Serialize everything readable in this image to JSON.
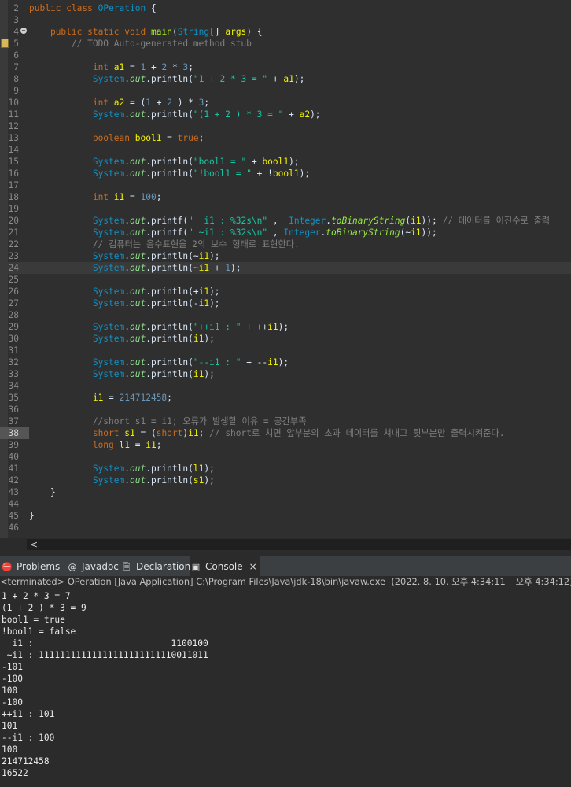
{
  "editor": {
    "fold_icon": "minus-circle-icon",
    "override_icon": "override-marker-icon",
    "lines": [
      {
        "n": "2",
        "parts": [
          [
            "kw",
            "public"
          ],
          [
            "txt",
            " "
          ],
          [
            "kw",
            "class"
          ],
          [
            "txt",
            " "
          ],
          [
            "cls",
            "OPeration"
          ],
          [
            "txt",
            " {"
          ]
        ]
      },
      {
        "n": "3",
        "parts": []
      },
      {
        "n": "4",
        "parts": [
          [
            "txt",
            "    "
          ],
          [
            "kw",
            "public"
          ],
          [
            "txt",
            " "
          ],
          [
            "kw",
            "static"
          ],
          [
            "txt",
            " "
          ],
          [
            "kw",
            "void"
          ],
          [
            "txt",
            " "
          ],
          [
            "mth",
            "main"
          ],
          [
            "txt",
            "("
          ],
          [
            "cls",
            "String"
          ],
          [
            "txt",
            "[] "
          ],
          [
            "var",
            "args"
          ],
          [
            "txt",
            ") {"
          ]
        ]
      },
      {
        "n": "5",
        "parts": [
          [
            "cmt",
            "        // "
          ],
          [
            "cmt",
            "TODO"
          ],
          [
            "cmt",
            " Auto-generated method stub"
          ]
        ]
      },
      {
        "n": "6",
        "parts": []
      },
      {
        "n": "7",
        "parts": [
          [
            "txt",
            "            "
          ],
          [
            "kw",
            "int"
          ],
          [
            "txt",
            " "
          ],
          [
            "var",
            "a1"
          ],
          [
            "txt",
            " = "
          ],
          [
            "num",
            "1"
          ],
          [
            "txt",
            " + "
          ],
          [
            "num",
            "2"
          ],
          [
            "txt",
            " * "
          ],
          [
            "num",
            "3"
          ],
          [
            "txt",
            ";"
          ]
        ]
      },
      {
        "n": "8",
        "parts": [
          [
            "txt",
            "            "
          ],
          [
            "cls",
            "System"
          ],
          [
            "txt",
            "."
          ],
          [
            "fld",
            "out"
          ],
          [
            "txt",
            ".println("
          ],
          [
            "str",
            "\"1 + 2 * 3 = \""
          ],
          [
            "txt",
            " + "
          ],
          [
            "var",
            "a1"
          ],
          [
            "txt",
            ");"
          ]
        ]
      },
      {
        "n": "9",
        "parts": []
      },
      {
        "n": "10",
        "parts": [
          [
            "txt",
            "            "
          ],
          [
            "kw",
            "int"
          ],
          [
            "txt",
            " "
          ],
          [
            "var",
            "a2"
          ],
          [
            "txt",
            " = ("
          ],
          [
            "num",
            "1"
          ],
          [
            "txt",
            " + "
          ],
          [
            "num",
            "2"
          ],
          [
            "txt",
            " ) * "
          ],
          [
            "num",
            "3"
          ],
          [
            "txt",
            ";"
          ]
        ]
      },
      {
        "n": "11",
        "parts": [
          [
            "txt",
            "            "
          ],
          [
            "cls",
            "System"
          ],
          [
            "txt",
            "."
          ],
          [
            "fld",
            "out"
          ],
          [
            "txt",
            ".println("
          ],
          [
            "str",
            "\"(1 + 2 ) * 3 = \""
          ],
          [
            "txt",
            " + "
          ],
          [
            "var",
            "a2"
          ],
          [
            "txt",
            ");"
          ]
        ]
      },
      {
        "n": "12",
        "parts": []
      },
      {
        "n": "13",
        "parts": [
          [
            "txt",
            "            "
          ],
          [
            "kw",
            "boolean"
          ],
          [
            "txt",
            " "
          ],
          [
            "var",
            "bool1"
          ],
          [
            "txt",
            " = "
          ],
          [
            "kw",
            "true"
          ],
          [
            "txt",
            ";"
          ]
        ]
      },
      {
        "n": "14",
        "parts": []
      },
      {
        "n": "15",
        "parts": [
          [
            "txt",
            "            "
          ],
          [
            "cls",
            "System"
          ],
          [
            "txt",
            "."
          ],
          [
            "fld",
            "out"
          ],
          [
            "txt",
            ".println("
          ],
          [
            "str",
            "\"bool1 = \""
          ],
          [
            "txt",
            " + "
          ],
          [
            "var",
            "bool1"
          ],
          [
            "txt",
            ");"
          ]
        ]
      },
      {
        "n": "16",
        "parts": [
          [
            "txt",
            "            "
          ],
          [
            "cls",
            "System"
          ],
          [
            "txt",
            "."
          ],
          [
            "fld",
            "out"
          ],
          [
            "txt",
            ".println("
          ],
          [
            "str",
            "\"!bool1 = \""
          ],
          [
            "txt",
            " + !"
          ],
          [
            "var",
            "bool1"
          ],
          [
            "txt",
            ");"
          ]
        ]
      },
      {
        "n": "17",
        "parts": []
      },
      {
        "n": "18",
        "parts": [
          [
            "txt",
            "            "
          ],
          [
            "kw",
            "int"
          ],
          [
            "txt",
            " "
          ],
          [
            "var",
            "i1"
          ],
          [
            "txt",
            " = "
          ],
          [
            "num",
            "100"
          ],
          [
            "txt",
            ";"
          ]
        ]
      },
      {
        "n": "19",
        "parts": []
      },
      {
        "n": "20",
        "parts": [
          [
            "txt",
            "            "
          ],
          [
            "cls",
            "System"
          ],
          [
            "txt",
            "."
          ],
          [
            "fld",
            "out"
          ],
          [
            "txt",
            ".printf("
          ],
          [
            "str",
            "\"  i1 : %32s\\n\""
          ],
          [
            "txt",
            " ,  "
          ],
          [
            "cls",
            "Integer"
          ],
          [
            "txt",
            "."
          ],
          [
            "smth",
            "toBinaryString"
          ],
          [
            "txt",
            "("
          ],
          [
            "var",
            "i1"
          ],
          [
            "txt",
            "));"
          ],
          [
            "cmt",
            " // 데이터를 이진수로 출력"
          ]
        ]
      },
      {
        "n": "21",
        "parts": [
          [
            "txt",
            "            "
          ],
          [
            "cls",
            "System"
          ],
          [
            "txt",
            "."
          ],
          [
            "fld",
            "out"
          ],
          [
            "txt",
            ".printf("
          ],
          [
            "str",
            "\" ~i1 : %32s\\n\""
          ],
          [
            "txt",
            " , "
          ],
          [
            "cls",
            "Integer"
          ],
          [
            "txt",
            "."
          ],
          [
            "smth",
            "toBinaryString"
          ],
          [
            "txt",
            "(~"
          ],
          [
            "var",
            "i1"
          ],
          [
            "txt",
            "));"
          ]
        ]
      },
      {
        "n": "22",
        "parts": [
          [
            "cmt",
            "            // 컴퓨터는 음수표현을 2의 보수 형태로 표현한다."
          ]
        ]
      },
      {
        "n": "23",
        "parts": [
          [
            "txt",
            "            "
          ],
          [
            "cls",
            "System"
          ],
          [
            "txt",
            "."
          ],
          [
            "fld",
            "out"
          ],
          [
            "txt",
            ".println(~"
          ],
          [
            "var",
            "i1"
          ],
          [
            "txt",
            ");"
          ]
        ]
      },
      {
        "n": "24",
        "parts": [
          [
            "txt",
            "            "
          ],
          [
            "cls",
            "System"
          ],
          [
            "txt",
            "."
          ],
          [
            "fld",
            "out"
          ],
          [
            "txt",
            ".println(~"
          ],
          [
            "var",
            "i1"
          ],
          [
            "txt",
            " + "
          ],
          [
            "num",
            "1"
          ],
          [
            "txt",
            ");"
          ]
        ],
        "current": true
      },
      {
        "n": "25",
        "parts": []
      },
      {
        "n": "26",
        "parts": [
          [
            "txt",
            "            "
          ],
          [
            "cls",
            "System"
          ],
          [
            "txt",
            "."
          ],
          [
            "fld",
            "out"
          ],
          [
            "txt",
            ".println(+"
          ],
          [
            "var",
            "i1"
          ],
          [
            "txt",
            ");"
          ]
        ]
      },
      {
        "n": "27",
        "parts": [
          [
            "txt",
            "            "
          ],
          [
            "cls",
            "System"
          ],
          [
            "txt",
            "."
          ],
          [
            "fld",
            "out"
          ],
          [
            "txt",
            ".println(-"
          ],
          [
            "var",
            "i1"
          ],
          [
            "txt",
            ");"
          ]
        ]
      },
      {
        "n": "28",
        "parts": []
      },
      {
        "n": "29",
        "parts": [
          [
            "txt",
            "            "
          ],
          [
            "cls",
            "System"
          ],
          [
            "txt",
            "."
          ],
          [
            "fld",
            "out"
          ],
          [
            "txt",
            ".println("
          ],
          [
            "str",
            "\"++i1 : \""
          ],
          [
            "txt",
            " + ++"
          ],
          [
            "var",
            "i1"
          ],
          [
            "txt",
            ");"
          ]
        ]
      },
      {
        "n": "30",
        "parts": [
          [
            "txt",
            "            "
          ],
          [
            "cls",
            "System"
          ],
          [
            "txt",
            "."
          ],
          [
            "fld",
            "out"
          ],
          [
            "txt",
            ".println("
          ],
          [
            "var",
            "i1"
          ],
          [
            "txt",
            ");"
          ]
        ]
      },
      {
        "n": "31",
        "parts": []
      },
      {
        "n": "32",
        "parts": [
          [
            "txt",
            "            "
          ],
          [
            "cls",
            "System"
          ],
          [
            "txt",
            "."
          ],
          [
            "fld",
            "out"
          ],
          [
            "txt",
            ".println("
          ],
          [
            "str",
            "\"--i1 : \""
          ],
          [
            "txt",
            " + --"
          ],
          [
            "var",
            "i1"
          ],
          [
            "txt",
            ");"
          ]
        ]
      },
      {
        "n": "33",
        "parts": [
          [
            "txt",
            "            "
          ],
          [
            "cls",
            "System"
          ],
          [
            "txt",
            "."
          ],
          [
            "fld",
            "out"
          ],
          [
            "txt",
            ".println("
          ],
          [
            "var",
            "i1"
          ],
          [
            "txt",
            ");"
          ]
        ]
      },
      {
        "n": "34",
        "parts": []
      },
      {
        "n": "35",
        "parts": [
          [
            "txt",
            "            "
          ],
          [
            "var",
            "i1"
          ],
          [
            "txt",
            " = "
          ],
          [
            "num",
            "214712458"
          ],
          [
            "txt",
            ";"
          ]
        ]
      },
      {
        "n": "36",
        "parts": []
      },
      {
        "n": "37",
        "parts": [
          [
            "cmt",
            "            //short s1 = i1; 오류가 발생할 이유 = 공간부족"
          ]
        ]
      },
      {
        "n": "38",
        "parts": [
          [
            "txt",
            "            "
          ],
          [
            "kw",
            "short"
          ],
          [
            "txt",
            " "
          ],
          [
            "var",
            "s1"
          ],
          [
            "txt",
            " = ("
          ],
          [
            "kw",
            "short"
          ],
          [
            "txt",
            ")"
          ],
          [
            "var",
            "i1"
          ],
          [
            "txt",
            ";"
          ],
          [
            "cmt",
            " // short로 치면 앞부분의 초과 데이터를 쳐내고 뒷부분만 출력시켜준다."
          ]
        ],
        "hl": true
      },
      {
        "n": "39",
        "parts": [
          [
            "txt",
            "            "
          ],
          [
            "kw",
            "long"
          ],
          [
            "txt",
            " "
          ],
          [
            "var",
            "l1"
          ],
          [
            "txt",
            " = "
          ],
          [
            "var",
            "i1"
          ],
          [
            "txt",
            ";"
          ]
        ]
      },
      {
        "n": "40",
        "parts": []
      },
      {
        "n": "41",
        "parts": [
          [
            "txt",
            "            "
          ],
          [
            "cls",
            "System"
          ],
          [
            "txt",
            "."
          ],
          [
            "fld",
            "out"
          ],
          [
            "txt",
            ".println("
          ],
          [
            "var",
            "l1"
          ],
          [
            "txt",
            ");"
          ]
        ]
      },
      {
        "n": "42",
        "parts": [
          [
            "txt",
            "            "
          ],
          [
            "cls",
            "System"
          ],
          [
            "txt",
            "."
          ],
          [
            "fld",
            "out"
          ],
          [
            "txt",
            ".println("
          ],
          [
            "var",
            "s1"
          ],
          [
            "txt",
            ");"
          ]
        ]
      },
      {
        "n": "43",
        "parts": [
          [
            "txt",
            "    }"
          ]
        ]
      },
      {
        "n": "44",
        "parts": []
      },
      {
        "n": "45",
        "parts": [
          [
            "txt",
            "}"
          ]
        ]
      },
      {
        "n": "46",
        "parts": []
      }
    ]
  },
  "scrollbar": {
    "left_arrow": "<",
    "icon": "scroll-left-arrow-icon"
  },
  "tabs": [
    {
      "label": "Problems",
      "icon": "problems-icon",
      "glyph": "⛔"
    },
    {
      "label": "Javadoc",
      "icon": "javadoc-icon",
      "glyph": "@"
    },
    {
      "label": "Declaration",
      "icon": "declaration-icon",
      "glyph": "🗎"
    },
    {
      "label": "Console",
      "icon": "console-icon",
      "glyph": "▣",
      "active": true,
      "close": "×"
    }
  ],
  "console": {
    "header": "<terminated> OPeration [Java Application] C:\\Program Files\\Java\\jdk-18\\bin\\javaw.exe  (2022. 8. 10. 오후 4:34:11 – 오후 4:34:12)",
    "output": [
      "1 + 2 * 3 = 7",
      "(1 + 2 ) * 3 = 9",
      "bool1 = true",
      "!bool1 = false",
      "  i1 :                          1100100",
      " ~i1 : 11111111111111111111111110011011",
      "-101",
      "-100",
      "100",
      "-100",
      "++i1 : 101",
      "101",
      "--i1 : 100",
      "100",
      "214712458",
      "16522"
    ]
  }
}
